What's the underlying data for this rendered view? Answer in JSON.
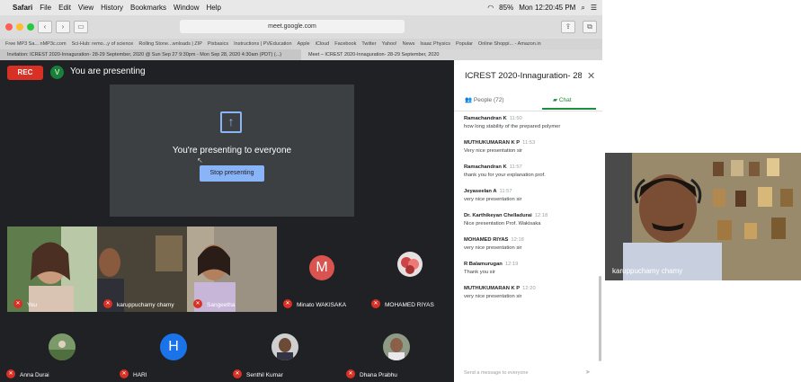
{
  "menubar": {
    "app": "Safari",
    "items": [
      "File",
      "Edit",
      "View",
      "History",
      "Bookmarks",
      "Window",
      "Help"
    ],
    "battery": "85%",
    "clock": "Mon 12:20:45 PM"
  },
  "browser": {
    "url": "meet.google.com",
    "favorites": [
      "Free MP3 Sa... nMP3c.com",
      "Sci-Hub: remo...y of science",
      "Rolling Stone...wnloads | ZIP",
      "Pixbasics",
      "Instructions | PVEducation",
      "Apple",
      "iCloud",
      "Facebook",
      "Twitter",
      "Yahoo!",
      "News",
      "Isaac Physics",
      "Popular",
      "Online Shoppi... - Amazon.in"
    ],
    "tabs": [
      "Invitation: ICREST 2020-Innaguration- 28-29 September, 2020 @ Sun Sep 27 9:30pm - Mon Sep 28, 2020 4:30am (PDT) (...)",
      "Meet – ICREST 2020-Innaguration- 28-29 September, 2020"
    ]
  },
  "meet": {
    "rec_label": "REC",
    "user_initial": "V",
    "presenting_label": "You are presenting",
    "present_text": "You're presenting to everyone",
    "stop_button": "Stop presenting",
    "tiles": [
      {
        "name": "You"
      },
      {
        "name": "karuppuchamy chamy"
      },
      {
        "name": "Sangeetha"
      },
      {
        "name": "Minato WAKISAKA",
        "initial": "M"
      },
      {
        "name": "MOHAMED RIYAS"
      },
      {
        "name": "Anna Durai"
      },
      {
        "name": "HARI",
        "initial": "H"
      },
      {
        "name": "Senthil Kumar"
      },
      {
        "name": "Dhana Prabhu"
      }
    ]
  },
  "chat": {
    "title": "ICREST 2020-Innaguration- 28-2...",
    "people_tab": "People (72)",
    "chat_tab": "Chat",
    "messages": [
      {
        "sender": "Ramachandran K",
        "time": "11:50",
        "text": "how long stability of the prepared polymer"
      },
      {
        "sender": "MUTHUKUMARAN K P",
        "time": "11:53",
        "text": "Very nice presentation sir"
      },
      {
        "sender": "Ramachandran K",
        "time": "11:57",
        "text": "thank you for your explanation  prof."
      },
      {
        "sender": "Jeyaseelan A",
        "time": "11:57",
        "text": "very nice presentation sir"
      },
      {
        "sender": "Dr. Karthikeyan Chelladurai",
        "time": "12:18",
        "text": "Nice presentation Prof. Wakisaka"
      },
      {
        "sender": "MOHAMED RIYAS",
        "time": "12:18",
        "text": "very nice presentation sir"
      },
      {
        "sender": "R Balamurugan",
        "time": "12:19",
        "text": "Thank you sir"
      },
      {
        "sender": "MUTHUKUMARAN K P",
        "time": "12:20",
        "text": "very nice presentation sir"
      }
    ],
    "input_placeholder": "Send a message to everyone"
  },
  "speaker": {
    "name": "karuppuchamy chamy"
  },
  "colors": {
    "meet_bg": "#202124",
    "rec": "#d93025",
    "accent": "#8ab4f8",
    "chat_green": "#1e8e3e"
  }
}
